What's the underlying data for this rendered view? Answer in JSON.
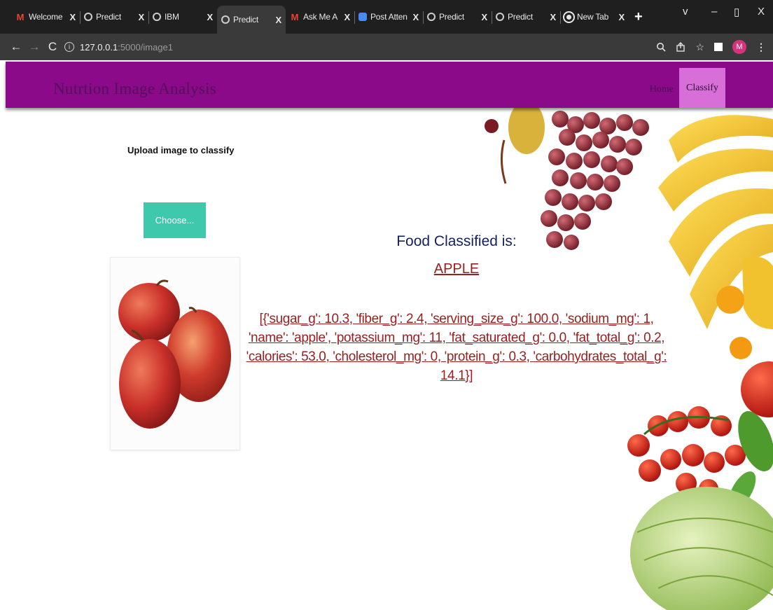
{
  "browser": {
    "tabs": [
      {
        "title": "Welcome",
        "icon": "gmail-icon",
        "close": "X"
      },
      {
        "title": "Predict",
        "icon": "globe-icon",
        "close": "X"
      },
      {
        "title": "IBM",
        "icon": "globe-icon",
        "close": "X"
      },
      {
        "title": "Predict",
        "icon": "globe-icon",
        "close": "X",
        "active": true
      },
      {
        "title": "Ask Me A",
        "icon": "gmail-icon",
        "close": "X"
      },
      {
        "title": "Post Atten",
        "icon": "meet-icon",
        "close": "X"
      },
      {
        "title": "Predict",
        "icon": "globe-icon",
        "close": "X"
      },
      {
        "title": "Predict",
        "icon": "globe-icon",
        "close": "X"
      },
      {
        "title": "New Tab",
        "icon": "chrome-icon",
        "close": "X"
      }
    ],
    "new_tab": "+",
    "window_controls": {
      "dropdown": "v",
      "minimize": "–",
      "restore": "▯",
      "close": "X"
    },
    "url_host": "127.0.0.1",
    "url_path": ":5000/image1",
    "profile_initial": "M"
  },
  "navbar": {
    "brand": "Nutrtion Image Analysis",
    "links": {
      "home": "Home",
      "classify": "Classify"
    }
  },
  "upload": {
    "heading": "Upload image to classify",
    "button": "Choose..."
  },
  "result": {
    "label": "Food Classified is:",
    "food": "APPLE",
    "nutrition": "[{'sugar_g': 10.3, 'fiber_g': 2.4, 'serving_size_g': 100.0, 'sodium_mg': 1, 'name': 'apple', 'potassium_mg': 11, 'fat_saturated_g': 0.0, 'fat_total_g': 0.2, 'calories': 53.0, 'cholesterol_mg': 0, 'protein_g': 0.3, 'carbohydrates_total_g': 14.1}]"
  },
  "colors": {
    "navbar": "#8a0a8a",
    "active_nav": "#d86fd8",
    "button": "#3ec9ad",
    "result_text": "#9a1e1e",
    "label_text": "#16205e"
  }
}
